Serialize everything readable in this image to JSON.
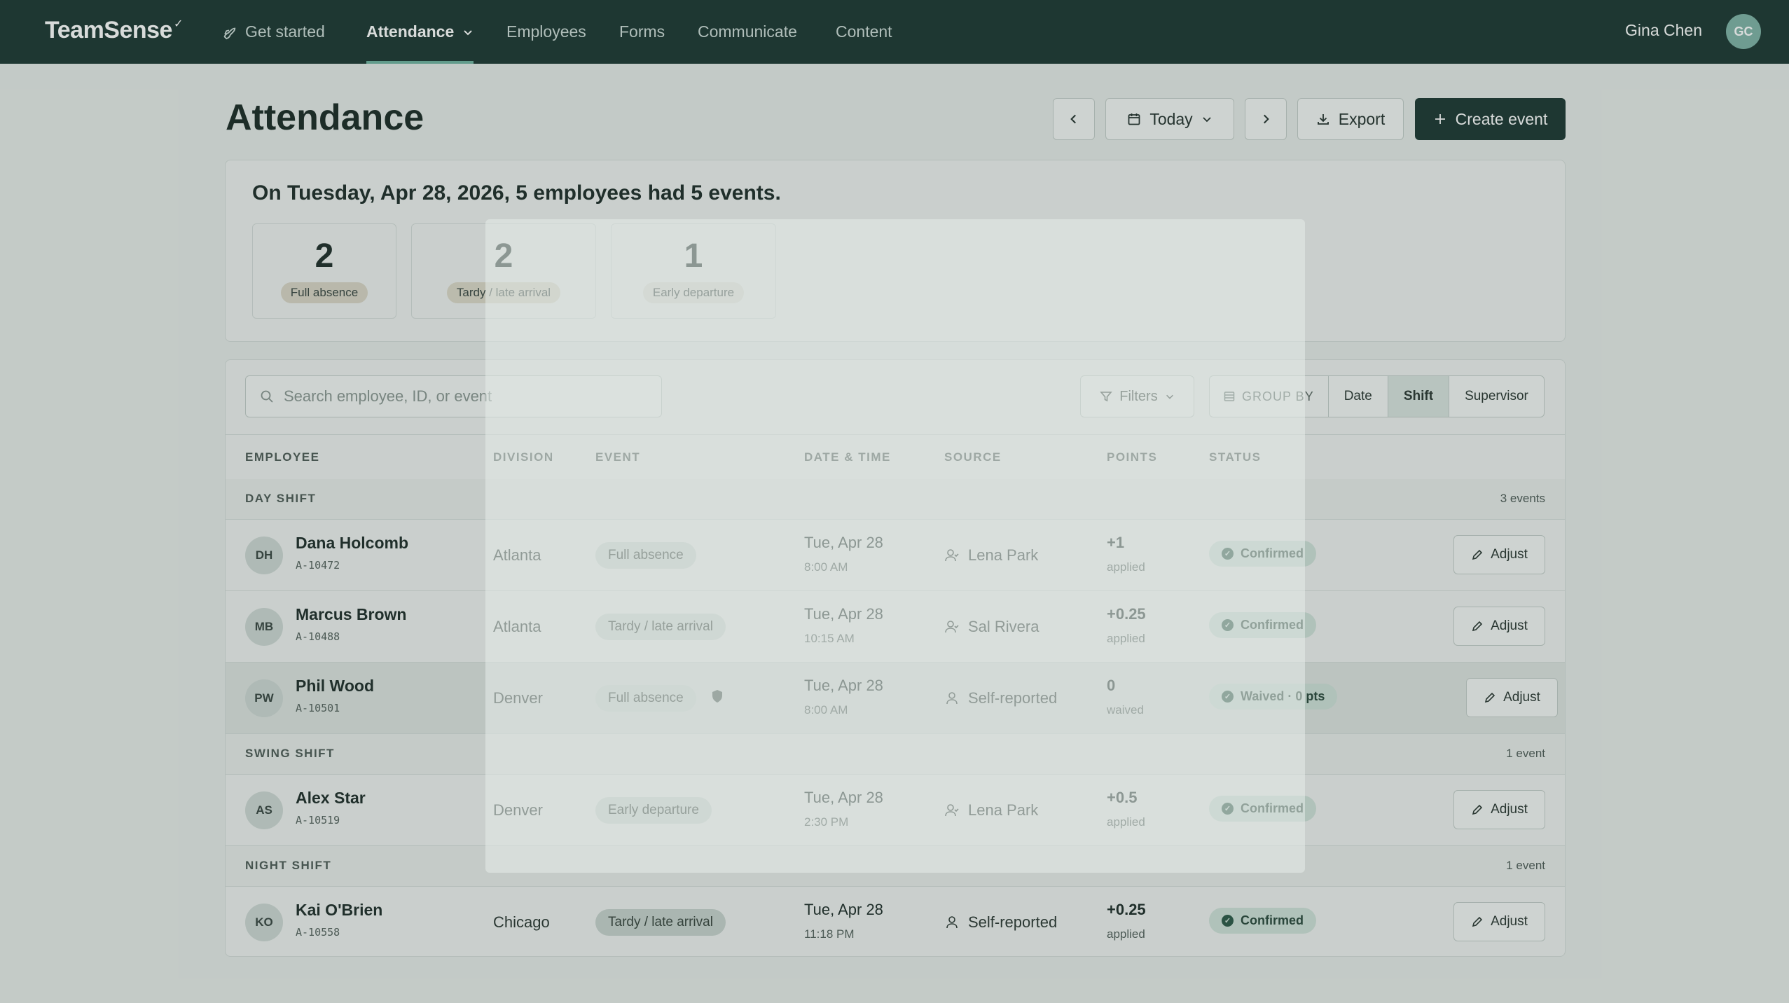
{
  "nav": {
    "logo": "TeamSense",
    "items": [
      {
        "label": "Get started",
        "icon": "rocket-icon"
      },
      {
        "label": "Attendance",
        "icon": "chevron-down-icon"
      },
      {
        "label": "Employees"
      },
      {
        "label": "Forms"
      },
      {
        "label": "Communicate"
      },
      {
        "label": "Content"
      }
    ],
    "user_name": "Gina Chen",
    "user_initials": "GC"
  },
  "page": {
    "title": "Attendance",
    "today_label": "Today",
    "export_label": "Export",
    "create_label": "Create event"
  },
  "summary": {
    "headline": "On Tuesday, Apr 28, 2026, 5 employees had 5 events.",
    "stats": [
      {
        "value": "2",
        "label": "Full absence"
      },
      {
        "value": "2",
        "label": "Tardy / late arrival"
      },
      {
        "value": "1",
        "label": "Early departure"
      }
    ]
  },
  "toolbar": {
    "search_placeholder": "Search employee, ID, or event",
    "filters_label": "Filters",
    "groupby_label": "GROUP BY",
    "groupby_options": [
      "Date",
      "Shift",
      "Supervisor"
    ],
    "groupby_selected": "Shift"
  },
  "table": {
    "headers": [
      "EMPLOYEE",
      "DIVISION",
      "EVENT",
      "DATE & TIME",
      "SOURCE",
      "POINTS",
      "STATUS"
    ],
    "adjust_label": "Adjust",
    "groups": [
      {
        "name": "DAY SHIFT",
        "count": "3 events",
        "rows": [
          {
            "initials": "DH",
            "name": "Dana Holcomb",
            "id": "A-10472",
            "division": "Atlanta",
            "event": "Full absence",
            "date": "Tue, Apr 28",
            "time": "8:00 AM",
            "source": "Lena Park",
            "points": "+1",
            "points_sub": "applied",
            "status": "Confirmed"
          },
          {
            "initials": "MB",
            "name": "Marcus Brown",
            "id": "A-10488",
            "division": "Atlanta",
            "event": "Tardy / late arrival",
            "date": "Tue, Apr 28",
            "time": "10:15 AM",
            "source": "Sal Rivera",
            "points": "+0.25",
            "points_sub": "applied",
            "status": "Confirmed"
          },
          {
            "initials": "PW",
            "name": "Phil Wood",
            "id": "A-10501",
            "division": "Denver",
            "event": "Full absence",
            "date": "Tue, Apr 28",
            "time": "8:00 AM",
            "source": "Self-reported",
            "points": "0",
            "points_sub": "waived",
            "status": "Waived · 0 pts"
          }
        ]
      },
      {
        "name": "SWING SHIFT",
        "count": "1 event",
        "rows": [
          {
            "initials": "AS",
            "name": "Alex Star",
            "id": "A-10519",
            "division": "Denver",
            "event": "Early departure",
            "date": "Tue, Apr 28",
            "time": "2:30 PM",
            "source": "Lena Park",
            "points": "+0.5",
            "points_sub": "applied",
            "status": "Confirmed"
          }
        ]
      },
      {
        "name": "NIGHT SHIFT",
        "count": "1 event",
        "rows": [
          {
            "initials": "KO",
            "name": "Kai O'Brien",
            "id": "A-10558",
            "division": "Chicago",
            "event": "Tardy / late arrival",
            "date": "Tue, Apr 28",
            "time": "11:18 PM",
            "source": "Self-reported",
            "points": "+0.25",
            "points_sub": "applied",
            "status": "Confirmed"
          }
        ]
      }
    ]
  },
  "colors": {
    "nav_bg": "#1d3833",
    "primary": "#1d3833",
    "accent": "#6fb3a0",
    "confirmed_bg": "#cfe1d8"
  }
}
